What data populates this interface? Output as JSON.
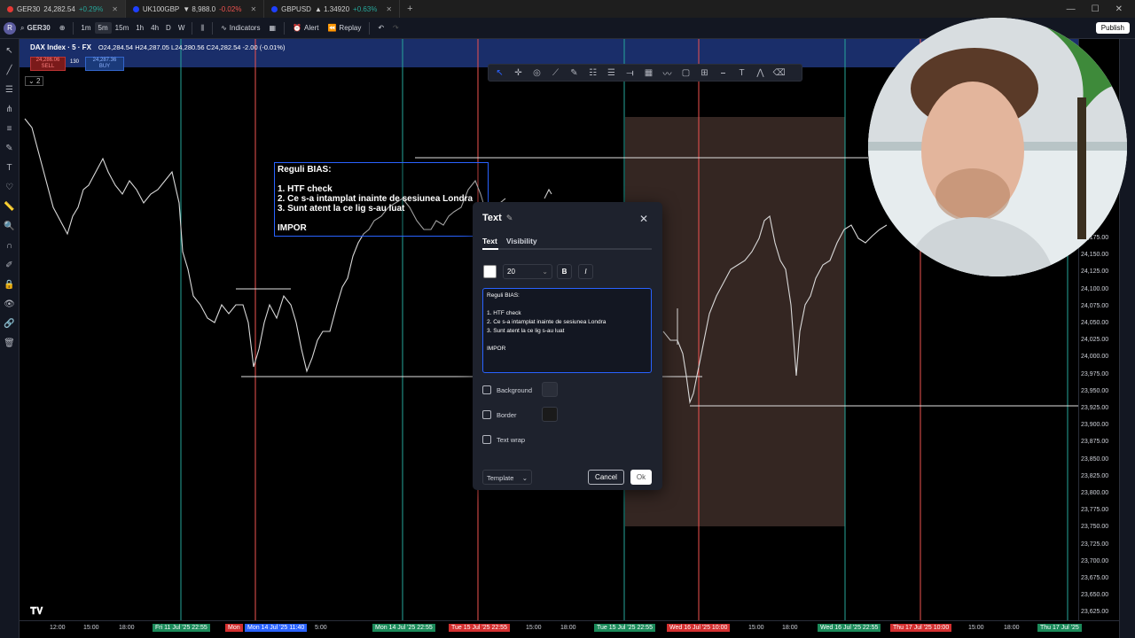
{
  "browser": {
    "tabs": [
      {
        "label": "GER30",
        "price": "24,282.54",
        "change": "+0.29%",
        "trend": "up",
        "flag_color": "#e53935"
      },
      {
        "label": "UK100GBP",
        "price": "▼ 8,988.0",
        "change": "-0.02%",
        "trend": "down",
        "flag_color": "#1e40ff"
      },
      {
        "label": "GBPUSD",
        "price": "▲ 1.34920",
        "change": "+0.63%",
        "trend": "up",
        "flag_color": "#1e40ff"
      }
    ],
    "new_tab": "+"
  },
  "toolbar": {
    "avatar_letter": "R",
    "symbol": "GER30",
    "timeframes": [
      "1m",
      "5m",
      "15m",
      "1h",
      "4h",
      "D",
      "W"
    ],
    "selected_timeframe": "5m",
    "indicators_label": "Indicators",
    "alert_label": "Alert",
    "replay_label": "Replay",
    "publish_label": "Publish"
  },
  "chart": {
    "legend_title": "DAX Index · 5 · FX",
    "ohlc": "O24,284.54  H24,287.05  L24,280.56  C24,282.54  -2.00 (-0.01%)",
    "sell_price": "24,286.06",
    "sell_label": "SELL",
    "buy_price": "24,287.36",
    "buy_label": "BUY",
    "spread": "130",
    "pane_label": "2",
    "textbox_text": "Reguli BIAS:\n\n1. HTF check\n2. Ce s-a intamplat inainte de sesiunea Londra\n3. Sunt atent la ce lig s-au luat\n\nIMPOR",
    "price_ticks": [
      "24,175.00",
      "24,150.00",
      "24,125.00",
      "24,100.00",
      "24,075.00",
      "24,050.00",
      "24,025.00",
      "24,000.00",
      "23,975.00",
      "23,950.00",
      "23,925.00",
      "23,900.00",
      "23,875.00",
      "23,850.00",
      "23,825.00",
      "23,800.00",
      "23,775.00",
      "23,750.00",
      "23,725.00",
      "23,700.00",
      "23,675.00",
      "23,650.00",
      "23,625.00"
    ],
    "time_ticks": [
      {
        "label": "12:00",
        "hl": ""
      },
      {
        "label": "15:00",
        "hl": ""
      },
      {
        "label": "18:00",
        "hl": ""
      },
      {
        "label": "Fri 11 Jul '25  22:55",
        "hl": "#1b8a5a"
      },
      {
        "label": "Mon",
        "hl": "#d32f2f"
      },
      {
        "label": "Mon 14 Jul '25  11:40",
        "hl": "#2962ff"
      },
      {
        "label": "5:00",
        "hl": ""
      },
      {
        "label": "Mon 14 Jul '25  22:55",
        "hl": "#1b8a5a"
      },
      {
        "label": "Tue 15 Jul '25  22:55",
        "hl": "#d32f2f"
      },
      {
        "label": "15:00",
        "hl": ""
      },
      {
        "label": "18:00",
        "hl": ""
      },
      {
        "label": "Tue 15 Jul '25  22:55",
        "hl": "#1b8a5a"
      },
      {
        "label": "Wed 16 Jul '25  10:00",
        "hl": "#d32f2f"
      },
      {
        "label": "15:00",
        "hl": ""
      },
      {
        "label": "18:00",
        "hl": ""
      },
      {
        "label": "Wed 16 Jul '25  22:55",
        "hl": "#1b8a5a"
      },
      {
        "label": "Thu 17 Jul '25  10:00",
        "hl": "#d32f2f"
      },
      {
        "label": "15:00",
        "hl": ""
      },
      {
        "label": "18:00",
        "hl": ""
      },
      {
        "label": "Thu 17 Jul '25",
        "hl": "#1b8a5a"
      }
    ]
  },
  "dialog": {
    "title": "Text",
    "tabs": [
      "Text",
      "Visibility"
    ],
    "font_size": "20",
    "bold_label": "B",
    "italic_label": "I",
    "text_value": "Reguli BIAS:\n\n1. HTF check\n2. Ce s-a intamplat inainte de sesiunea Londra\n3. Sunt atent la ce lig s-au luat\n\nIMPOR",
    "background_label": "Background",
    "border_label": "Border",
    "textwrap_label": "Text wrap",
    "template_label": "Template",
    "cancel_label": "Cancel",
    "ok_label": "Ok"
  },
  "colors": {
    "green_line": "#26a69a",
    "red_line": "#ef5350",
    "highlight_zone": "#3a2a26",
    "accent": "#2962ff"
  }
}
